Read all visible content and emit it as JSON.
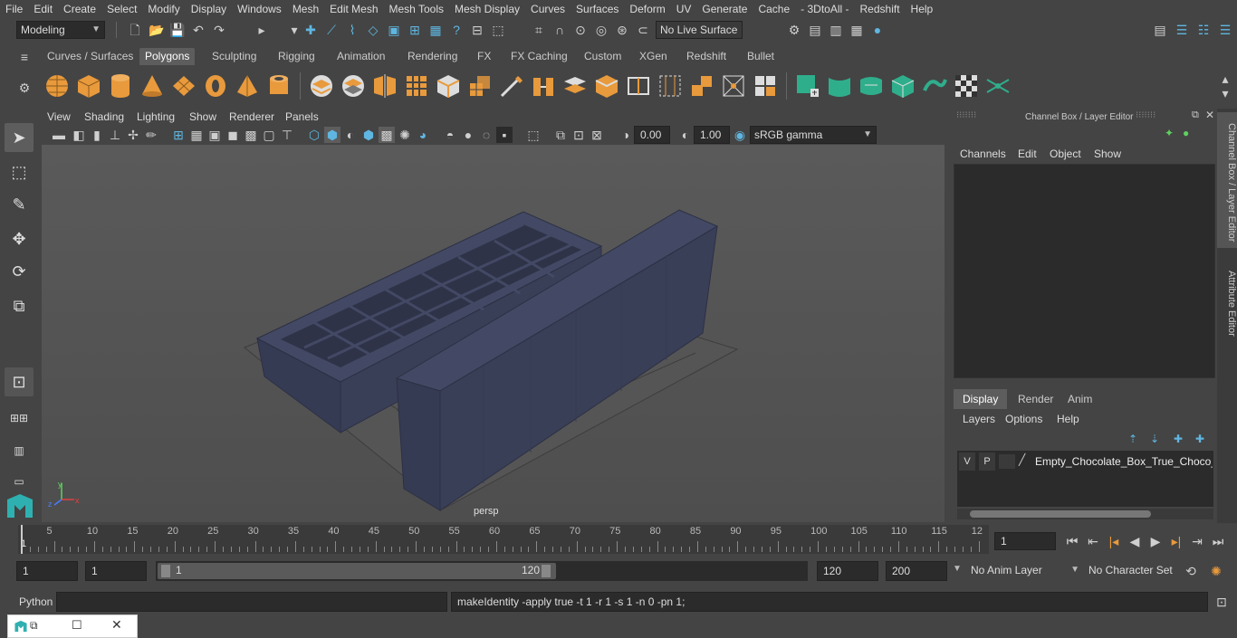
{
  "menubar": [
    "File",
    "Edit",
    "Create",
    "Select",
    "Modify",
    "Display",
    "Windows",
    "Mesh",
    "Edit Mesh",
    "Mesh Tools",
    "Mesh Display",
    "Curves",
    "Surfaces",
    "Deform",
    "UV",
    "Generate",
    "Cache",
    "- 3DtoAll -",
    "Redshift",
    "Help"
  ],
  "status": {
    "workspace": "Modeling",
    "live_surface": "No Live Surface"
  },
  "shelf_tabs": [
    "Curves / Surfaces",
    "Polygons",
    "Sculpting",
    "Rigging",
    "Animation",
    "Rendering",
    "FX",
    "FX Caching",
    "Custom",
    "XGen",
    "Redshift",
    "Bullet"
  ],
  "shelf_active": "Polygons",
  "panel_menus": [
    "View",
    "Shading",
    "Lighting",
    "Show",
    "Renderer",
    "Panels"
  ],
  "panel_toolbar": {
    "exposure": "0.00",
    "gamma": "1.00",
    "color_space": "sRGB gamma"
  },
  "viewport": {
    "camera_label": "persp",
    "axis_x": "x",
    "axis_y": "y",
    "axis_z": "z"
  },
  "channel_box": {
    "title": "Channel Box / Layer Editor",
    "menus": [
      "Channels",
      "Edit",
      "Object",
      "Show"
    ]
  },
  "layer_editor": {
    "tabs": [
      "Display",
      "Render",
      "Anim"
    ],
    "active_tab": "Display",
    "menus": [
      "Layers",
      "Options",
      "Help"
    ],
    "layers": [
      {
        "v": "V",
        "p": "P",
        "name": "Empty_Chocolate_Box_True_Choco_Op"
      }
    ]
  },
  "side_tabs": [
    "Channel Box / Layer Editor",
    "Attribute Editor"
  ],
  "timeline": {
    "ticks": [
      "5",
      "10",
      "15",
      "20",
      "25",
      "30",
      "35",
      "40",
      "45",
      "50",
      "55",
      "60",
      "65",
      "70",
      "75",
      "80",
      "85",
      "90",
      "95",
      "100",
      "105",
      "110",
      "115",
      "12"
    ],
    "start_marker": "1",
    "current_frame": "1"
  },
  "range": {
    "start": "1",
    "playback_start": "1",
    "slider_start": "1",
    "slider_end": "120",
    "playback_end": "120",
    "end": "200",
    "anim_layer": "No Anim Layer",
    "character_set": "No Character Set"
  },
  "command": {
    "language": "Python",
    "input": "",
    "result": "makeIdentity -apply true -t 1 -r 1 -s 1 -n 0 -pn 1;"
  },
  "colors": {
    "bg": "#444444",
    "field": "#2b2b2b",
    "mesh": "#3a3f58",
    "accent_orange": "#e89a3c",
    "accent_green": "#2fae8c",
    "accent_blue": "#5fb6e0"
  }
}
